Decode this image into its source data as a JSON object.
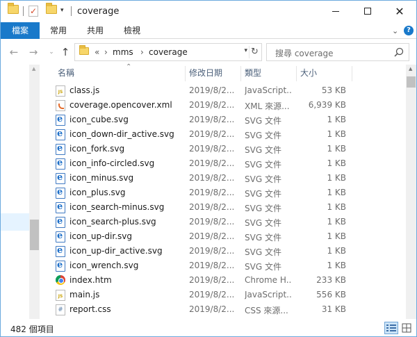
{
  "window": {
    "title": "coverage",
    "controls": {
      "minimize": "minimize",
      "maximize": "maximize",
      "close": "close"
    }
  },
  "ribbon": {
    "tabs": [
      "檔案",
      "常用",
      "共用",
      "檢視"
    ]
  },
  "address": {
    "overflow": "«",
    "crumbs": [
      "mms",
      "coverage"
    ],
    "search_placeholder": "搜尋 coverage"
  },
  "columns": [
    "名稱",
    "修改日期",
    "類型",
    "大小"
  ],
  "files": [
    {
      "name": "class.js",
      "date": "2019/8/2...",
      "type": "JavaScript...",
      "size": "53 KB",
      "icon": "js-file-icon"
    },
    {
      "name": "coverage.opencover.xml",
      "date": "2019/8/2...",
      "type": "XML 來源...",
      "size": "6,939 KB",
      "icon": "xml-file-icon"
    },
    {
      "name": "icon_cube.svg",
      "date": "2019/8/2...",
      "type": "SVG 文件",
      "size": "1 KB",
      "icon": "svg-file-icon"
    },
    {
      "name": "icon_down-dir_active.svg",
      "date": "2019/8/2...",
      "type": "SVG 文件",
      "size": "1 KB",
      "icon": "svg-file-icon"
    },
    {
      "name": "icon_fork.svg",
      "date": "2019/8/2...",
      "type": "SVG 文件",
      "size": "1 KB",
      "icon": "svg-file-icon"
    },
    {
      "name": "icon_info-circled.svg",
      "date": "2019/8/2...",
      "type": "SVG 文件",
      "size": "1 KB",
      "icon": "svg-file-icon"
    },
    {
      "name": "icon_minus.svg",
      "date": "2019/8/2...",
      "type": "SVG 文件",
      "size": "1 KB",
      "icon": "svg-file-icon"
    },
    {
      "name": "icon_plus.svg",
      "date": "2019/8/2...",
      "type": "SVG 文件",
      "size": "1 KB",
      "icon": "svg-file-icon"
    },
    {
      "name": "icon_search-minus.svg",
      "date": "2019/8/2...",
      "type": "SVG 文件",
      "size": "1 KB",
      "icon": "svg-file-icon"
    },
    {
      "name": "icon_search-plus.svg",
      "date": "2019/8/2...",
      "type": "SVG 文件",
      "size": "1 KB",
      "icon": "svg-file-icon"
    },
    {
      "name": "icon_up-dir.svg",
      "date": "2019/8/2...",
      "type": "SVG 文件",
      "size": "1 KB",
      "icon": "svg-file-icon"
    },
    {
      "name": "icon_up-dir_active.svg",
      "date": "2019/8/2...",
      "type": "SVG 文件",
      "size": "1 KB",
      "icon": "svg-file-icon"
    },
    {
      "name": "icon_wrench.svg",
      "date": "2019/8/2...",
      "type": "SVG 文件",
      "size": "1 KB",
      "icon": "svg-file-icon"
    },
    {
      "name": "index.htm",
      "date": "2019/8/2...",
      "type": "Chrome H...",
      "size": "233 KB",
      "icon": "chrome-html-file-icon"
    },
    {
      "name": "main.js",
      "date": "2019/8/2...",
      "type": "JavaScript...",
      "size": "556 KB",
      "icon": "js-file-icon"
    },
    {
      "name": "report.css",
      "date": "2019/8/2...",
      "type": "CSS 來源...",
      "size": "31 KB",
      "icon": "css-file-icon"
    }
  ],
  "status": {
    "item_count": "482 個項目"
  },
  "colors": {
    "accent": "#1979ca",
    "header_text": "#4c607a",
    "selection": "#e5f3ff"
  }
}
